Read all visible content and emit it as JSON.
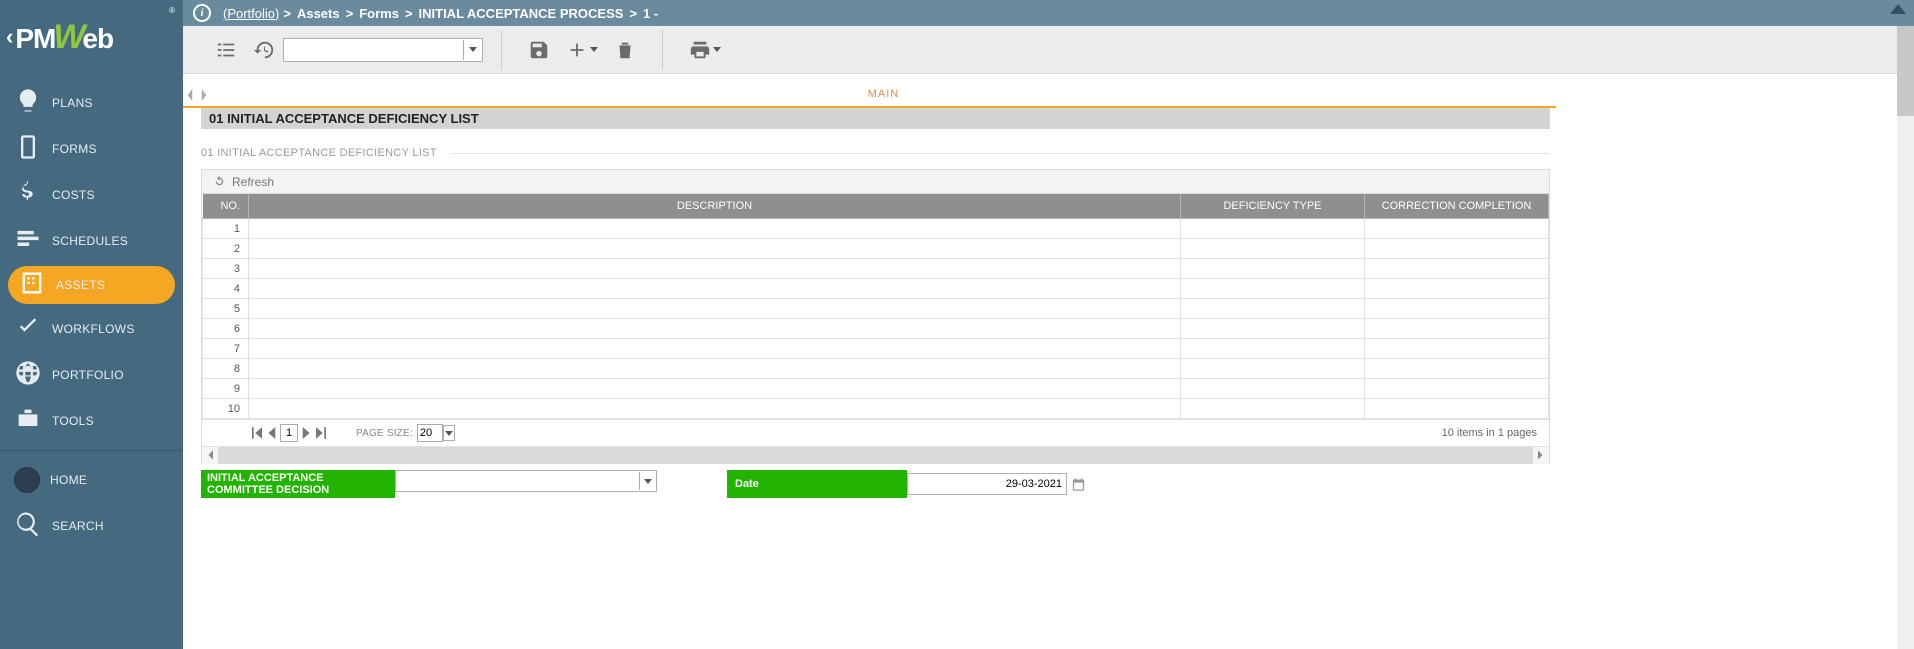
{
  "logo": {
    "before": "PM",
    "accent": "W",
    "after": "eb"
  },
  "sidebar": {
    "items": [
      {
        "label": "PLANS"
      },
      {
        "label": "FORMS"
      },
      {
        "label": "COSTS"
      },
      {
        "label": "SCHEDULES"
      },
      {
        "label": "ASSETS"
      },
      {
        "label": "WORKFLOWS"
      },
      {
        "label": "PORTFOLIO"
      },
      {
        "label": "TOOLS"
      },
      {
        "label": "HOME"
      },
      {
        "label": "SEARCH"
      }
    ]
  },
  "breadcrumb": {
    "portfolio": "(Portfolio)",
    "parts": [
      "Assets",
      "Forms",
      "INITIAL ACCEPTANCE PROCESS",
      "1 -"
    ]
  },
  "toolbar": {
    "search_value": ""
  },
  "tab": {
    "main": "MAIN"
  },
  "section": {
    "header": "01 INITIAL ACCEPTANCE DEFICIENCY LIST",
    "subheader": "01 INITIAL ACCEPTANCE DEFICIENCY LIST"
  },
  "grid": {
    "refresh": "Refresh",
    "columns": {
      "no": "NO.",
      "desc": "DESCRIPTION",
      "type": "DEFICIENCY TYPE",
      "corr": "CORRECTION COMPLETION"
    },
    "rows": [
      {
        "no": "1",
        "desc": "",
        "type": "",
        "corr": ""
      },
      {
        "no": "2",
        "desc": "",
        "type": "",
        "corr": ""
      },
      {
        "no": "3",
        "desc": "",
        "type": "",
        "corr": ""
      },
      {
        "no": "4",
        "desc": "",
        "type": "",
        "corr": ""
      },
      {
        "no": "5",
        "desc": "",
        "type": "",
        "corr": ""
      },
      {
        "no": "6",
        "desc": "",
        "type": "",
        "corr": ""
      },
      {
        "no": "7",
        "desc": "",
        "type": "",
        "corr": ""
      },
      {
        "no": "8",
        "desc": "",
        "type": "",
        "corr": ""
      },
      {
        "no": "9",
        "desc": "",
        "type": "",
        "corr": ""
      },
      {
        "no": "10",
        "desc": "",
        "type": "",
        "corr": ""
      }
    ],
    "pager": {
      "page": "1",
      "page_size_label": "PAGE SIZE:",
      "page_size": "20",
      "status": "10 items in 1 pages"
    }
  },
  "form": {
    "decision_label": "INITIAL ACCEPTANCE COMMITTEE DECISION",
    "decision_value": "",
    "date_label": "Date",
    "date_value": "29-03-2021"
  }
}
